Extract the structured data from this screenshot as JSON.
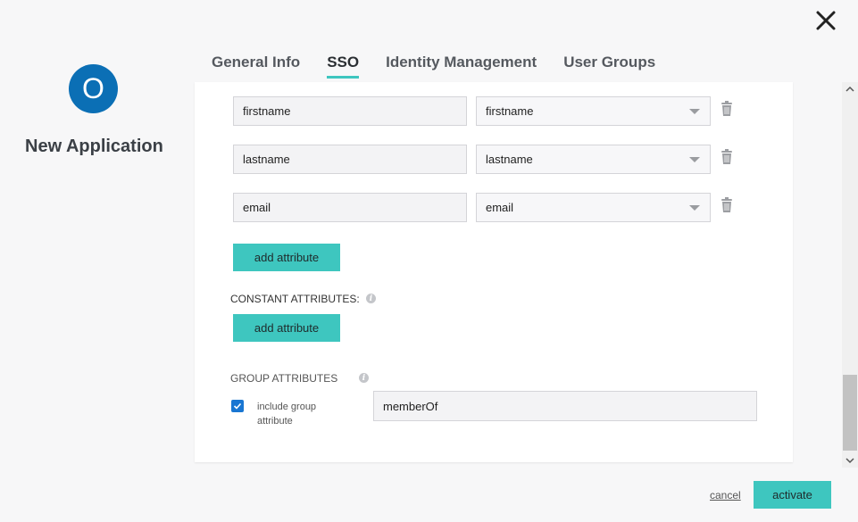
{
  "app": {
    "avatar_letter": "O",
    "title": "New Application",
    "accent_color": "#3ec6bf",
    "avatar_color": "#0b6fb5"
  },
  "tabs": [
    {
      "label": "General Info",
      "active": false
    },
    {
      "label": "SSO",
      "active": true
    },
    {
      "label": "Identity Management",
      "active": false
    },
    {
      "label": "User Groups",
      "active": false
    }
  ],
  "attributes": [
    {
      "name": "firstname",
      "value": "firstname"
    },
    {
      "name": "lastname",
      "value": "lastname"
    },
    {
      "name": "email",
      "value": "email"
    }
  ],
  "buttons": {
    "add_attribute": "add attribute",
    "add_constant_attribute": "add attribute",
    "cancel": "cancel",
    "activate": "activate"
  },
  "sections": {
    "constant_attributes": "CONSTANT ATTRIBUTES:",
    "group_attributes": "GROUP ATTRIBUTES"
  },
  "group": {
    "include_label": "include group attribute",
    "include_checked": true,
    "attribute_value": "memberOf"
  },
  "icons": {
    "close": "close-icon",
    "trash": "trash-icon",
    "info": "info-icon",
    "dropdown": "chevron-down-icon"
  }
}
